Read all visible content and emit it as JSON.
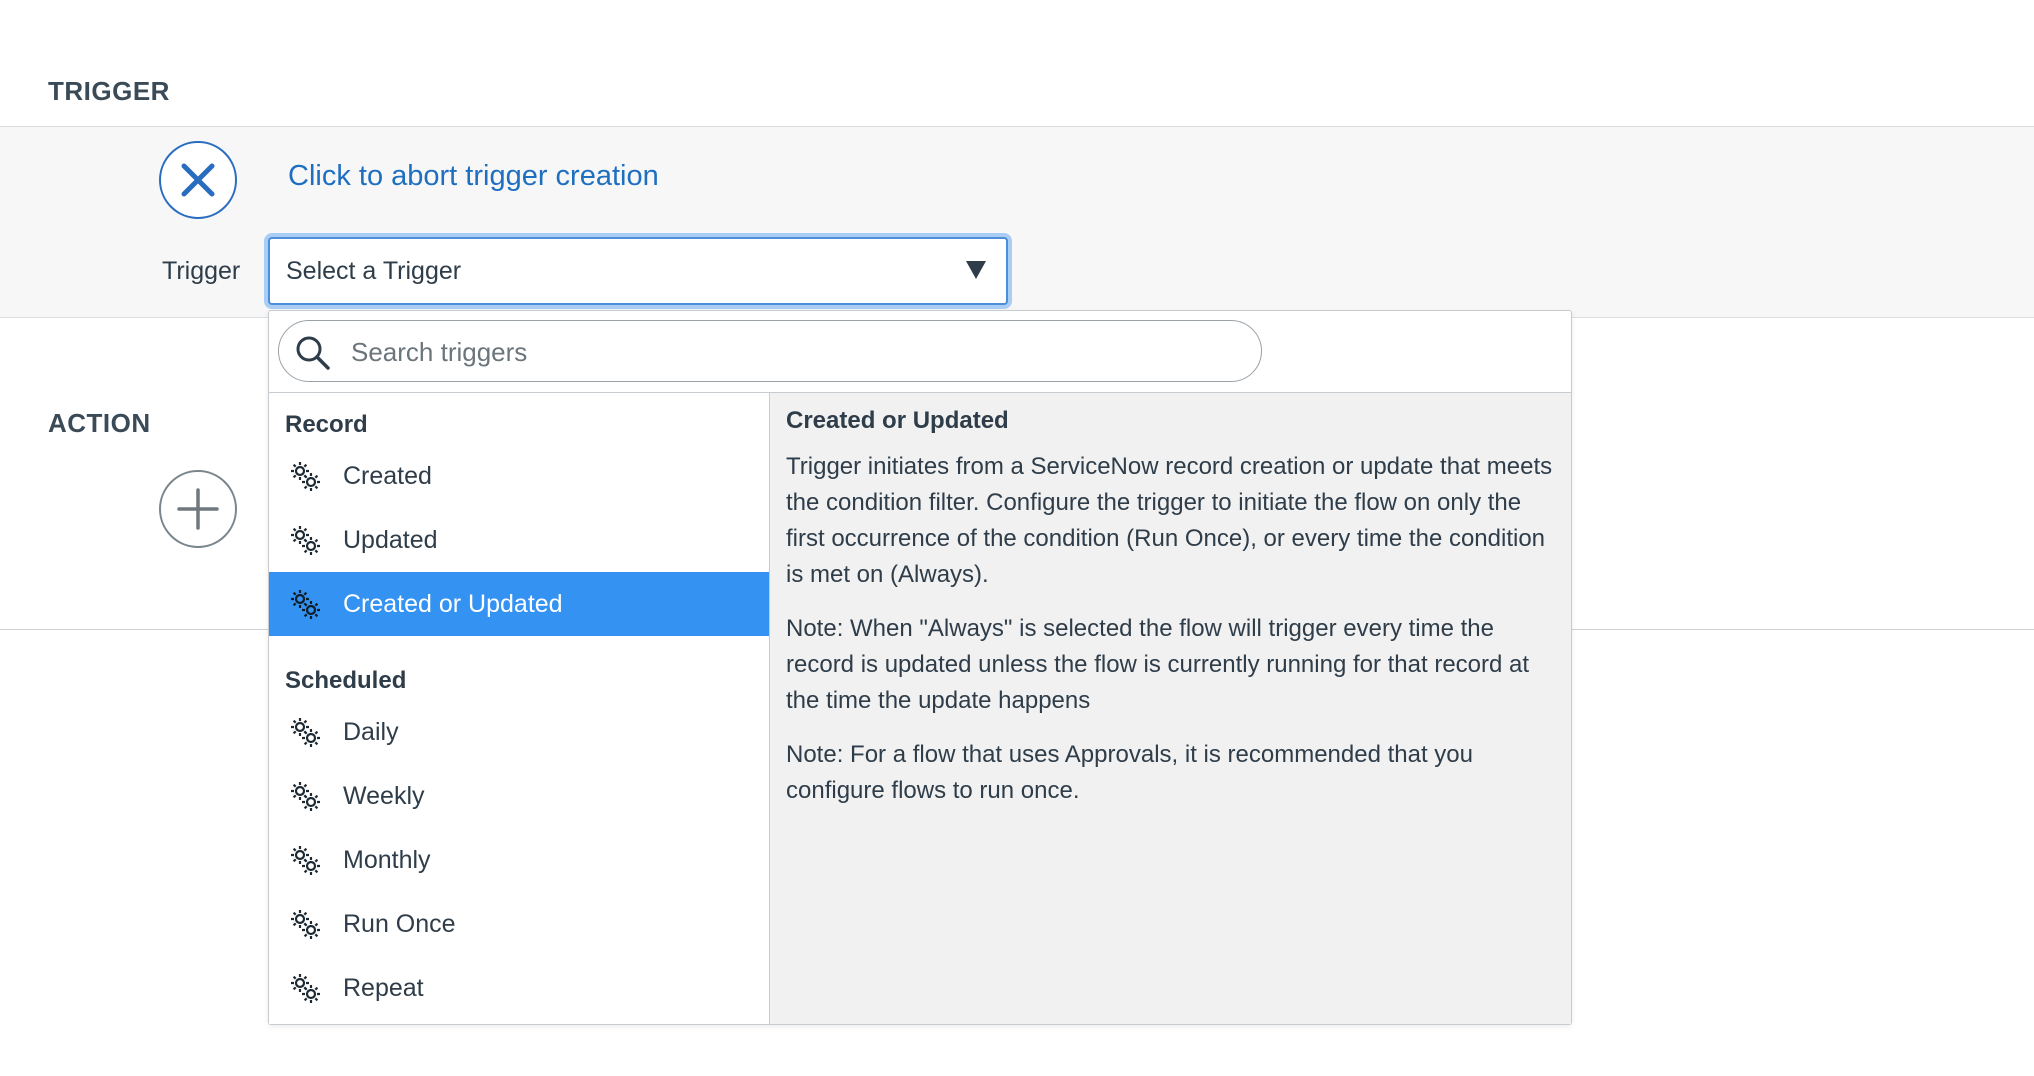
{
  "sections": {
    "trigger_label": "TRIGGER",
    "action_label": "ACTION"
  },
  "trigger_area": {
    "abort_link": "Click to abort trigger creation",
    "field_label": "Trigger",
    "select_value": "Select a Trigger"
  },
  "dropdown": {
    "search_placeholder": "Search triggers",
    "groups": [
      {
        "header": "Record",
        "items": [
          {
            "label": "Created",
            "selected": false
          },
          {
            "label": "Updated",
            "selected": false
          },
          {
            "label": "Created or Updated",
            "selected": true
          }
        ]
      },
      {
        "header": "Scheduled",
        "items": [
          {
            "label": "Daily",
            "selected": false
          },
          {
            "label": "Weekly",
            "selected": false
          },
          {
            "label": "Monthly",
            "selected": false
          },
          {
            "label": "Run Once",
            "selected": false
          },
          {
            "label": "Repeat",
            "selected": false
          }
        ]
      }
    ],
    "detail": {
      "title": "Created or Updated",
      "paragraphs": [
        "Trigger initiates from a ServiceNow record creation or update that meets the condition filter. Configure the trigger to initiate the flow on only the first occurrence of the condition (Run Once), or every time the condition is met on (Always).",
        "Note: When \"Always\" is selected the flow will trigger every time the record is updated unless the flow is currently running for that record at the time the update happens",
        "Note: For a flow that uses Approvals, it is recommended that you configure flows to run once."
      ]
    }
  },
  "icons": {
    "abort": "close-icon",
    "add": "plus-icon",
    "search": "search-icon",
    "list_item": "gears-icon",
    "select": "caret-down-icon"
  },
  "colors": {
    "link_blue": "#1f6fc1",
    "selected_bg": "#3392f2",
    "focus_ring": "#a9cdf5",
    "detail_bg": "#f1f1f1"
  }
}
